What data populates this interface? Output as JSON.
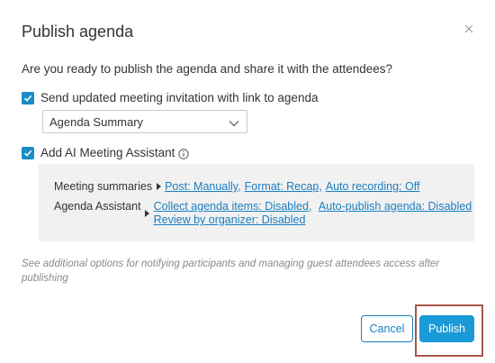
{
  "dialog": {
    "title": "Publish agenda",
    "close_icon": "close-icon",
    "question": "Are you ready to publish the agenda and share it with the attendees?"
  },
  "options": {
    "send_invitation": {
      "checked": true,
      "label": "Send updated meeting invitation with link to agenda"
    },
    "agenda_select": {
      "value": "Agenda Summary"
    },
    "ai_assistant": {
      "checked": true,
      "label": "Add AI Meeting Assistant",
      "info_icon": "info-icon"
    }
  },
  "panel": {
    "summaries": {
      "label": "Meeting summaries",
      "links": [
        "Post: Manually,",
        "Format: Recap,",
        "Auto recording: Off"
      ]
    },
    "assistant": {
      "label": "Agenda Assistant",
      "links": [
        "Collect agenda items: Disabled,",
        "Auto-publish agenda: Disabled",
        "Review by organizer: Disabled"
      ]
    }
  },
  "note": "See additional options for notifying participants and managing guest attendees access after publishing",
  "buttons": {
    "cancel": "Cancel",
    "publish": "Publish"
  },
  "colors": {
    "accent": "#1a9ad6",
    "link": "#1a7fc1",
    "highlight": "#a5574a",
    "panel_bg": "#f1f1f1"
  }
}
